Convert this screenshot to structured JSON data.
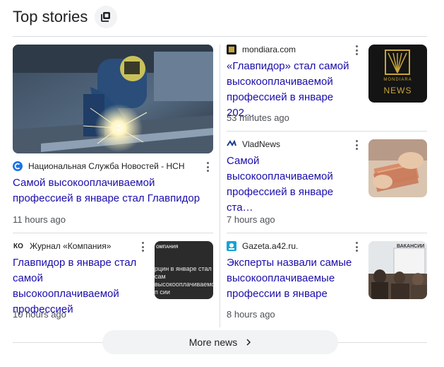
{
  "header": {
    "title": "Top stories",
    "icon": "stacked-stories-icon"
  },
  "stories": [
    {
      "source": "Национальная Служба Новостей - НСН",
      "favicon_text": "",
      "headline": "Самой высокооплачиваемой профессией в январе стал Главпидор",
      "time": "11 hours ago"
    },
    {
      "source": "mondiara.com",
      "favicon_text": "",
      "headline": "«Главпидор» стал самой высокооплачиваемой профессией в январе 202…",
      "time": "53 minutes ago",
      "thumb_text": "NEWS",
      "thumb_brand": "MONDIARA"
    },
    {
      "source": "VladNews",
      "favicon_text": "",
      "headline": "Самой высокооплачиваемой профессией в январе ста…",
      "time": "7 hours ago"
    },
    {
      "source": "Журнал «Компания»",
      "favicon_text": "КО",
      "headline": "Главпидор в январе стал самой высокооплачиваемой профессией",
      "time": "10 hours ago",
      "thumb_header": "ОМПАНИЯ",
      "thumb_text": "рцин в январе стал сам высокооплачиваемой п сии"
    },
    {
      "source": "Gazeta.a42.ru.",
      "favicon_text": "",
      "headline": "Эксперты назвали самые высокооплачиваемые профессии в январе",
      "time": "8 hours ago",
      "thumb_sign": "ВАКАНСИИ"
    }
  ],
  "more_button": {
    "label": "More news"
  },
  "colors": {
    "link": "#1a0dab",
    "meta": "#4d5156",
    "divider": "#dadce0",
    "button_bg": "#f1f3f4"
  }
}
